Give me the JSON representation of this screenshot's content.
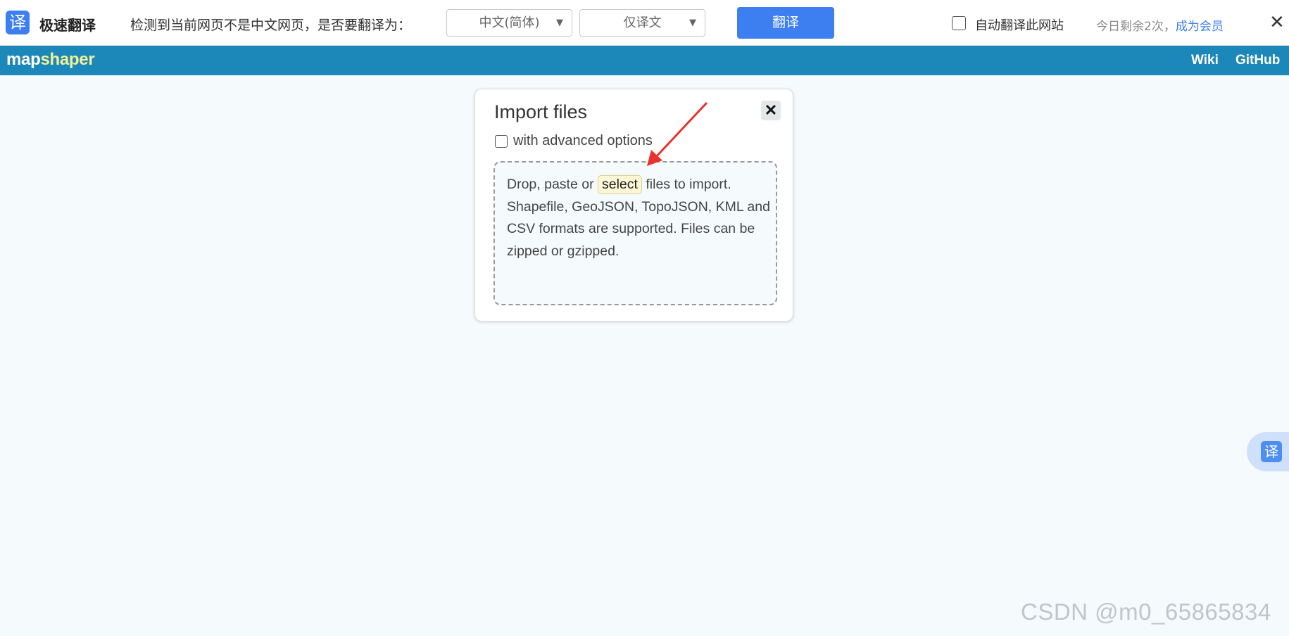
{
  "translate_bar": {
    "logo_glyph": "译",
    "brand": "极速翻译",
    "prompt": "检测到当前网页不是中文网页，是否要翻译为：",
    "target_language": "中文(简体)",
    "mode": "仅译文",
    "translate_button": "翻译",
    "auto_translate_label": "自动翻译此网站",
    "auto_translate_checked": false,
    "remaining_text": "今日剩余2次，",
    "member_link": "成为会员",
    "close_glyph": "✕",
    "accent_color": "#3d7ff0"
  },
  "app_header": {
    "logo_part1": "map",
    "logo_part2": "shaper",
    "links": [
      "Wiki",
      "GitHub"
    ],
    "bg_color": "#1c87b9"
  },
  "import_dialog": {
    "title": "Import files",
    "close_glyph": "✕",
    "advanced_label": "with advanced options",
    "advanced_checked": false,
    "drop_text_before": "Drop, paste or ",
    "select_label": "select",
    "drop_text_after": " files to import. Shapefile, GeoJSON, TopoJSON, KML and CSV formats are supported. Files can be zipped or gzipped."
  },
  "floating_translate": {
    "glyph": "译"
  },
  "annotation": {
    "arrow_color": "#e8322d"
  },
  "watermark": "CSDN @m0_65865834"
}
